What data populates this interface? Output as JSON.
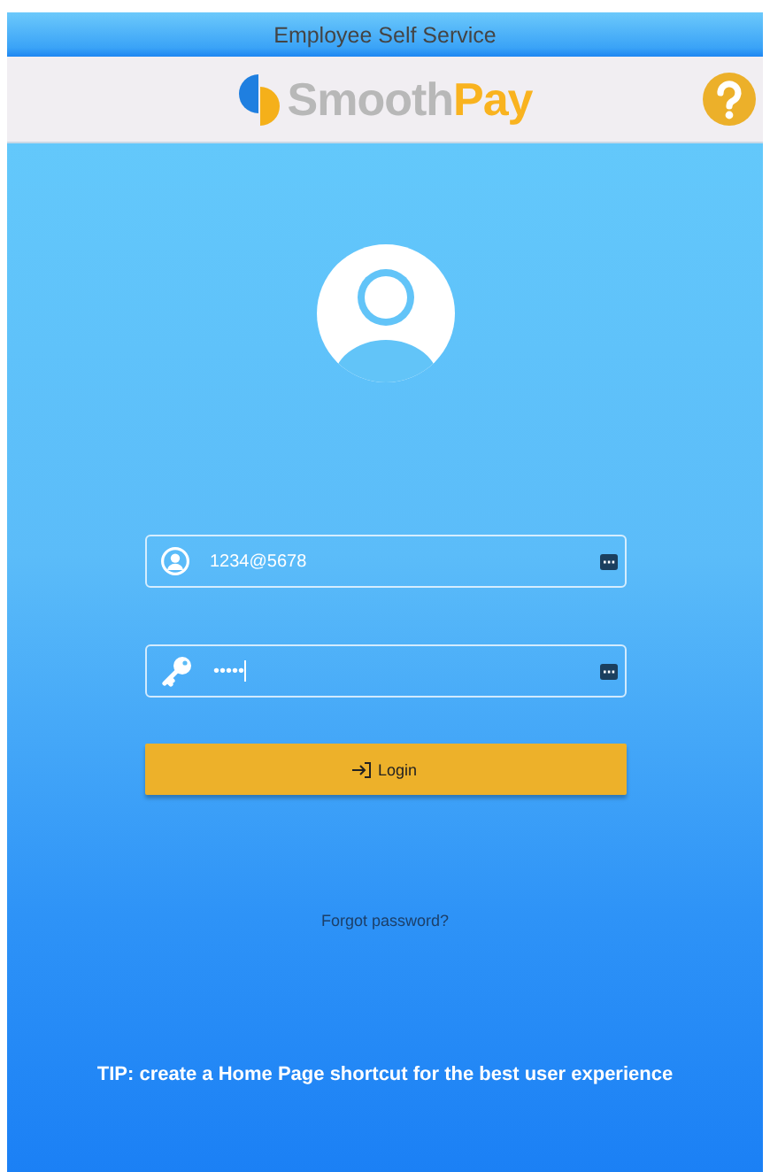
{
  "window": {
    "title": "Employee Self Service"
  },
  "logo": {
    "first": "Smooth",
    "second": "Pay"
  },
  "fields": [
    {
      "kind": "user",
      "value": "1234@5678"
    },
    {
      "kind": "password",
      "value": "•••••"
    }
  ],
  "login_button": {
    "label": "Login"
  },
  "forgot_link": "Forgot password?",
  "tip": "TIP: create a Home Page shortcut for the best user experience"
}
